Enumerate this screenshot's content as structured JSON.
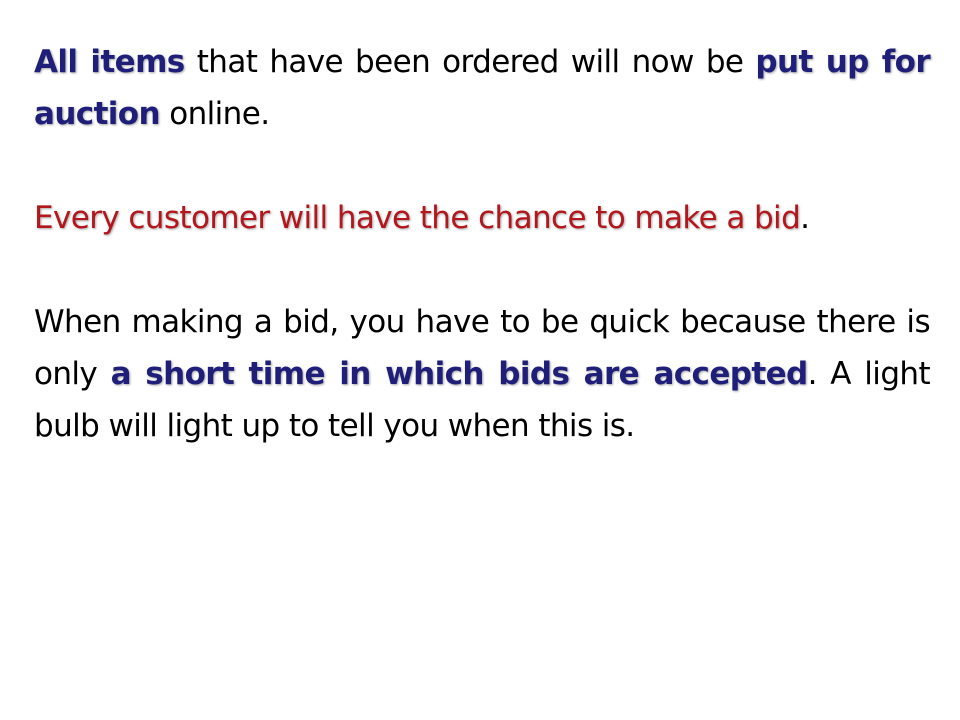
{
  "slide": {
    "paragraph_1": {
      "segment_1": "All items",
      "segment_2": " that have been ordered will now be ",
      "segment_3": "put up for auction",
      "segment_4": " online."
    },
    "paragraph_2": {
      "segment_1": "Every customer will have the chance to make a bid",
      "segment_2": "."
    },
    "paragraph_3": {
      "segment_1": "When making a bid, you have to be quick because there is only ",
      "segment_2": "a short time in which bids are accepted",
      "segment_3": ". A light bulb will light up to tell you when this is."
    }
  },
  "colors": {
    "emphasis_blue": "#1f1f7a",
    "emphasis_red": "#b3161c",
    "body_text": "#000000",
    "background": "#ffffff"
  }
}
